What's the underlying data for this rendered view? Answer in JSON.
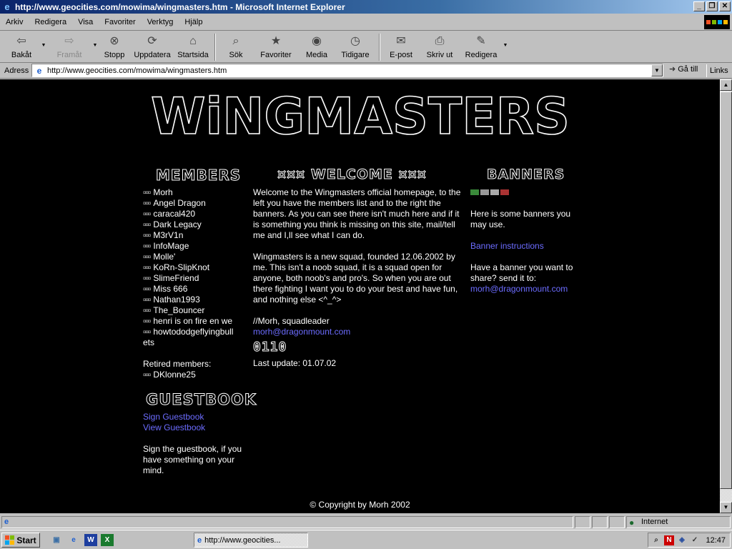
{
  "window": {
    "title": "http://www.geocities.com/mowima/wingmasters.htm - Microsoft Internet Explorer"
  },
  "menu": [
    "Arkiv",
    "Redigera",
    "Visa",
    "Favoriter",
    "Verktyg",
    "Hjälp"
  ],
  "toolbar": {
    "back": "Bakåt",
    "forward": "Framåt",
    "stop": "Stopp",
    "refresh": "Uppdatera",
    "home": "Startsida",
    "search": "Sök",
    "favorites": "Favoriter",
    "media": "Media",
    "history": "Tidigare",
    "mail": "E-post",
    "print": "Skriv ut",
    "edit": "Redigera"
  },
  "address": {
    "label": "Adress",
    "url": "http://www.geocities.com/mowima/wingmasters.htm",
    "go": "Gå till",
    "links": "Links"
  },
  "page": {
    "logo": "WiNGMASTERS",
    "members_title": "MEMBERS",
    "bullet": "¤¤¤",
    "members": [
      "Morh",
      "Angel Dragon",
      "caracal420",
      "Dark Legacy",
      "M3rV1n",
      "InfoMage",
      "Molle'",
      "KoRn-SlipKnot",
      "SlimeFriend",
      "Miss 666",
      "Nathan1993",
      "The_Bouncer",
      "henri is on fire en we",
      "howtododgeflyingbull",
      "ets"
    ],
    "retired_label": "Retired members:",
    "retired": [
      "DKlonne25"
    ],
    "guestbook_title": "GUESTBOOK",
    "sign_guestbook": "Sign Guestbook",
    "view_guestbook": "View Guestbook",
    "guestbook_text": "Sign the guestbook, if you have something on your mind.",
    "welcome_title": "¤¤¤ WELCOME ¤¤¤",
    "welcome_p1": "Welcome to the Wingmasters official homepage, to the left you have the members list and to the right the banners. As you can see there isn't much here and if it is something you think is missing on this site, mail/tell me and I,ll see what I can do.",
    "welcome_p2": "Wingmasters is a new squad, founded 12.06.2002 by me. This isn't a noob squad, it is a squad open for anyone, both noob's and pro's. So when you are out there fighting I want you to do your best and have fun, and nothing else <^_^>",
    "signature": "//Morh, squadleader",
    "email": "morh@dragonmount.com",
    "counter": "0110",
    "last_update": "Last update: 01.07.02",
    "banners_title": "BANNERS",
    "banners_text": "Here is some banners you may use.",
    "banner_instructions": "Banner instructions",
    "share_text": "Have a banner you want to share? send it to:",
    "share_email": "morh@dragonmount.com",
    "copyright": "© Copyright by Morh 2002"
  },
  "status": {
    "zone": "Internet"
  },
  "taskbar": {
    "start": "Start",
    "task": "http://www.geocities...",
    "clock": "12:47"
  },
  "colors": {
    "link": "#6c6cff",
    "titlebar": "#0a246a",
    "page_bg": "#000000"
  }
}
